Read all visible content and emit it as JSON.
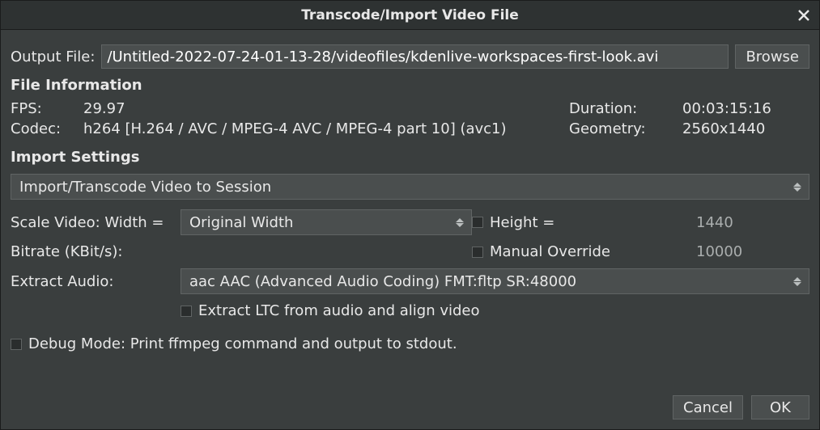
{
  "titlebar": {
    "title": "Transcode/Import Video File"
  },
  "outputFile": {
    "label": "Output File:",
    "value": "/Untitled-2022-07-24-01-13-28/videofiles/kdenlive-workspaces-first-look.avi",
    "browse_label": "Browse"
  },
  "fileInfo": {
    "heading": "File Information",
    "fps_label": "FPS:",
    "fps_value": "29.97",
    "codec_label": "Codec:",
    "codec_value": "h264 [H.264 / AVC / MPEG-4 AVC / MPEG-4 part 10] (avc1)",
    "duration_label": "Duration:",
    "duration_value": "00:03:15:16",
    "geometry_label": "Geometry:",
    "geometry_value": "2560x1440"
  },
  "importSettings": {
    "heading": "Import Settings",
    "mode": "Import/Transcode Video to Session",
    "scale_label": "Scale Video: Width =",
    "scale_value": "Original Width",
    "height_label": "Height =",
    "height_value": "1440",
    "bitrate_label": "Bitrate (KBit/s):",
    "manual_override_label": "Manual Override",
    "bitrate_value": "10000",
    "extract_audio_label": "Extract Audio:",
    "extract_audio_value": "aac AAC (Advanced Audio Coding) FMT:fltp SR:48000",
    "extract_ltc_label": "Extract LTC from audio and align video"
  },
  "debug": {
    "label": "Debug Mode: Print ffmpeg command and output to stdout."
  },
  "footer": {
    "cancel": "Cancel",
    "ok": "OK"
  }
}
